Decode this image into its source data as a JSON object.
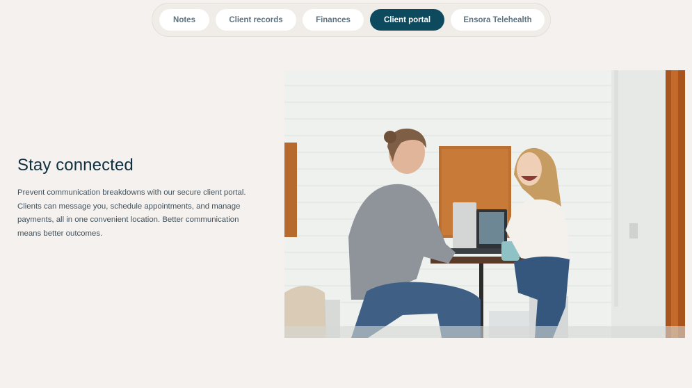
{
  "tabs": [
    {
      "label": "Notes",
      "active": false
    },
    {
      "label": "Client records",
      "active": false
    },
    {
      "label": "Finances",
      "active": false
    },
    {
      "label": "Client portal",
      "active": true
    },
    {
      "label": "Ensora Telehealth",
      "active": false
    }
  ],
  "section": {
    "heading": "Stay connected",
    "body": "Prevent communication breakdowns with our secure client portal. Clients can message you, schedule appointments, and manage payments, all in one convenient location. Better communication means better outcomes."
  },
  "colors": {
    "background": "#f5f1ee",
    "tab_active": "#0d4a5e",
    "tab_inactive": "#ffffff",
    "heading": "#0f2f40",
    "body_text": "#41525d"
  }
}
